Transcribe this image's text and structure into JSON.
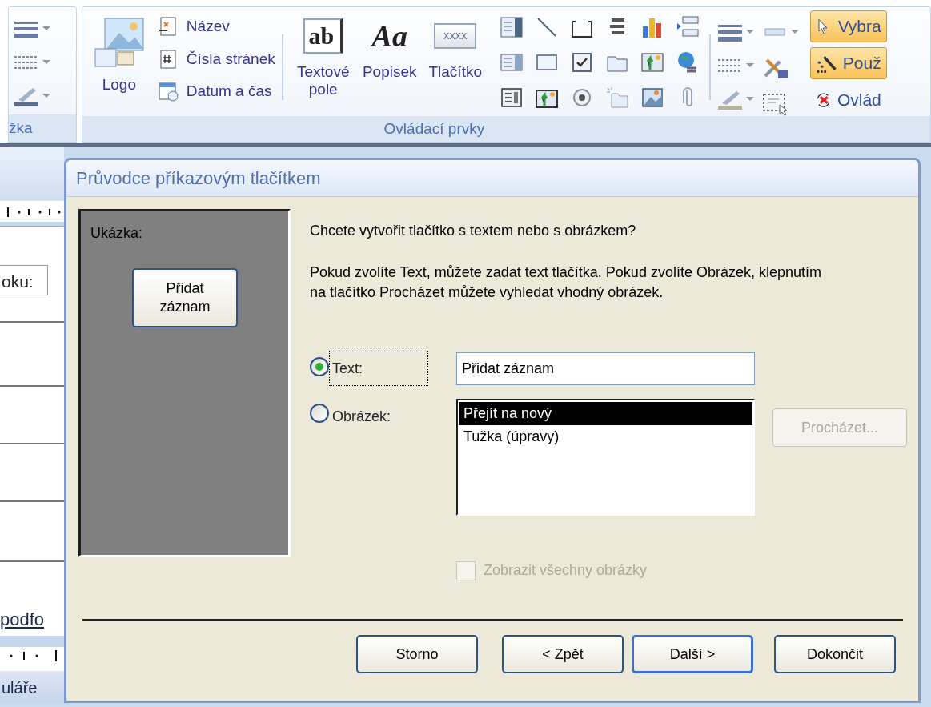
{
  "ribbon": {
    "left_group": {
      "label": "žka"
    },
    "controls_group": {
      "label": "Ovládací prvky",
      "logo": {
        "label": "Logo"
      },
      "header_items": [
        {
          "label": "Název",
          "kind": "title"
        },
        {
          "label": "Čísla stránek",
          "kind": "page_numbers"
        },
        {
          "label": "Datum a čas",
          "kind": "date_time"
        }
      ],
      "large_tools": [
        {
          "label": "Textové pole",
          "kind": "textbox",
          "icon_text": "ab"
        },
        {
          "label": "Popisek",
          "kind": "label",
          "icon_text": "Aa"
        },
        {
          "label": "Tlačítko",
          "kind": "button",
          "icon_text": "XXXX"
        }
      ],
      "tool_buttons": [
        {
          "label": "Vybra",
          "kind": "pointer",
          "on": true
        },
        {
          "label": "Použ",
          "kind": "wand",
          "on": true
        },
        {
          "label": "Ovlád",
          "kind": "activex",
          "on": false
        }
      ]
    }
  },
  "background_form": {
    "field_label": "oku:",
    "subform_label": "podfo",
    "section_label": "uláře"
  },
  "dialog": {
    "title": "Průvodce příkazovým tlačítkem",
    "preview": {
      "label": "Ukázka:",
      "button_text": "Přidat záznam"
    },
    "question": "Chcete vytvořit tlačítko s textem nebo s obrázkem?",
    "explanation": "Pokud zvolíte Text, můžete zadat text tlačítka. Pokud zvolíte Obrázek, klepnutím na tlačítko Procházet můžete vyhledat vhodný obrázek.",
    "options": [
      {
        "label": "Text:",
        "checked": true,
        "focused": true
      },
      {
        "label": "Obrázek:",
        "checked": false,
        "focused": false
      }
    ],
    "text_value": "Přidat záznam",
    "pictures": [
      {
        "label": "Přejít na nový",
        "selected": true
      },
      {
        "label": "Tužka (úpravy)",
        "selected": false
      }
    ],
    "browse_button": {
      "label": "Procházet...",
      "disabled": true
    },
    "show_all": {
      "label": "Zobrazit všechny obrázky",
      "checked": false,
      "disabled": true
    },
    "buttons": [
      {
        "label": "Storno",
        "default": false
      },
      {
        "label": "< Zpět",
        "default": false
      },
      {
        "label": "Další >",
        "default": true
      },
      {
        "label": "Dokončit",
        "default": false
      }
    ]
  }
}
